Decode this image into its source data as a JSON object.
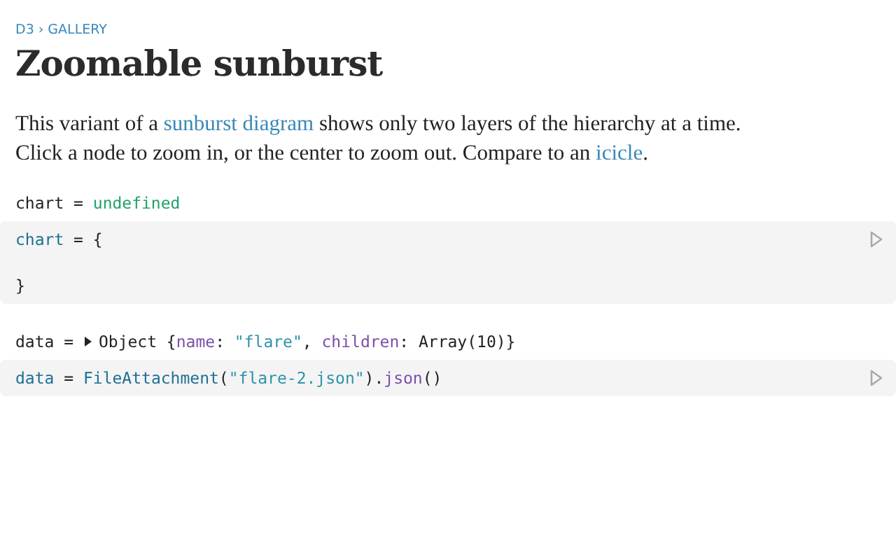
{
  "breadcrumb": {
    "items": [
      "D3",
      "GALLERY"
    ],
    "separator": "›"
  },
  "title": "Zoomable sunburst",
  "intro": [
    {
      "kind": "text",
      "text": "This variant of a "
    },
    {
      "kind": "link",
      "text": "sunburst diagram"
    },
    {
      "kind": "text",
      "text": " shows only two layers of the hierarchy at a time."
    },
    {
      "kind": "break"
    },
    {
      "kind": "text",
      "text": "Click a node to zoom in, or the center to zoom out. Compare to an "
    },
    {
      "kind": "link",
      "text": "icicle"
    },
    {
      "kind": "text",
      "text": "."
    }
  ],
  "cells": [
    {
      "output": {
        "expandable": false,
        "tokens": [
          {
            "kind": "plain",
            "text": "chart = "
          },
          {
            "kind": "undefined",
            "text": "undefined"
          }
        ]
      },
      "code": [
        [
          {
            "kind": "def",
            "text": "chart"
          },
          {
            "kind": "plain",
            "text": " = {"
          }
        ],
        [
          {
            "kind": "plain",
            "text": "}"
          }
        ]
      ]
    },
    {
      "output": {
        "expandable": true,
        "expanded": false,
        "tokens": [
          {
            "kind": "plain",
            "text": "data = "
          },
          {
            "kind": "plain",
            "text": "Object {"
          },
          {
            "kind": "prop",
            "text": "name"
          },
          {
            "kind": "plain",
            "text": ": "
          },
          {
            "kind": "string",
            "text": "\"flare\""
          },
          {
            "kind": "plain",
            "text": ", "
          },
          {
            "kind": "prop",
            "text": "children"
          },
          {
            "kind": "plain",
            "text": ": Array(10)}"
          }
        ]
      },
      "code": [
        [
          {
            "kind": "def",
            "text": "data"
          },
          {
            "kind": "plain",
            "text": " = "
          },
          {
            "kind": "def",
            "text": "FileAttachment"
          },
          {
            "kind": "plain",
            "text": "("
          },
          {
            "kind": "string",
            "text": "\"flare-2.json\""
          },
          {
            "kind": "plain",
            "text": ")."
          },
          {
            "kind": "prop",
            "text": "json"
          },
          {
            "kind": "plain",
            "text": "()"
          }
        ]
      ]
    }
  ]
}
